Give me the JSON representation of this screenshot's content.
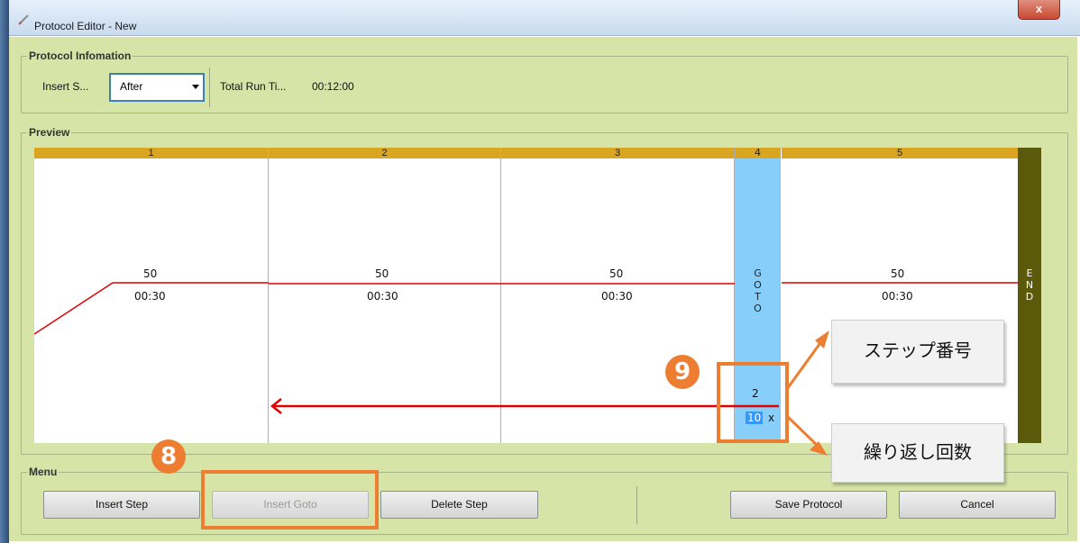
{
  "window": {
    "title": "Protocol Editor - New",
    "close_glyph": "x"
  },
  "protocol_info": {
    "group_title": "Protocol Infomation",
    "insert_step_label": "Insert S...",
    "insert_step_value": "After",
    "total_run_time_label": "Total Run Ti...",
    "total_run_time_value": "00:12:00"
  },
  "preview": {
    "group_title": "Preview",
    "steps": [
      {
        "number": "1",
        "temperature": "50",
        "time": "00:30"
      },
      {
        "number": "2",
        "temperature": "50",
        "time": "00:30"
      },
      {
        "number": "3",
        "temperature": "50",
        "time": "00:30"
      },
      {
        "number": "5",
        "temperature": "50",
        "time": "00:30"
      }
    ],
    "goto": {
      "number": "4",
      "label": "G\nO\nT\nO",
      "target_step": "2",
      "repeat_count": "10",
      "repeat_suffix": "x"
    },
    "end_label": "E\nN\nD"
  },
  "menu": {
    "group_title": "Menu",
    "insert_step": "Insert Step",
    "insert_goto": "Insert Goto",
    "delete_step": "Delete Step",
    "save_protocol": "Save Protocol",
    "cancel": "Cancel"
  },
  "annotations": {
    "badge_8": "8",
    "badge_9": "9",
    "callout_step_number": "ステップ番号",
    "callout_repeat_count": "繰り返し回数",
    "accent_color": "#ed7d31",
    "line_color": "#e00000"
  }
}
